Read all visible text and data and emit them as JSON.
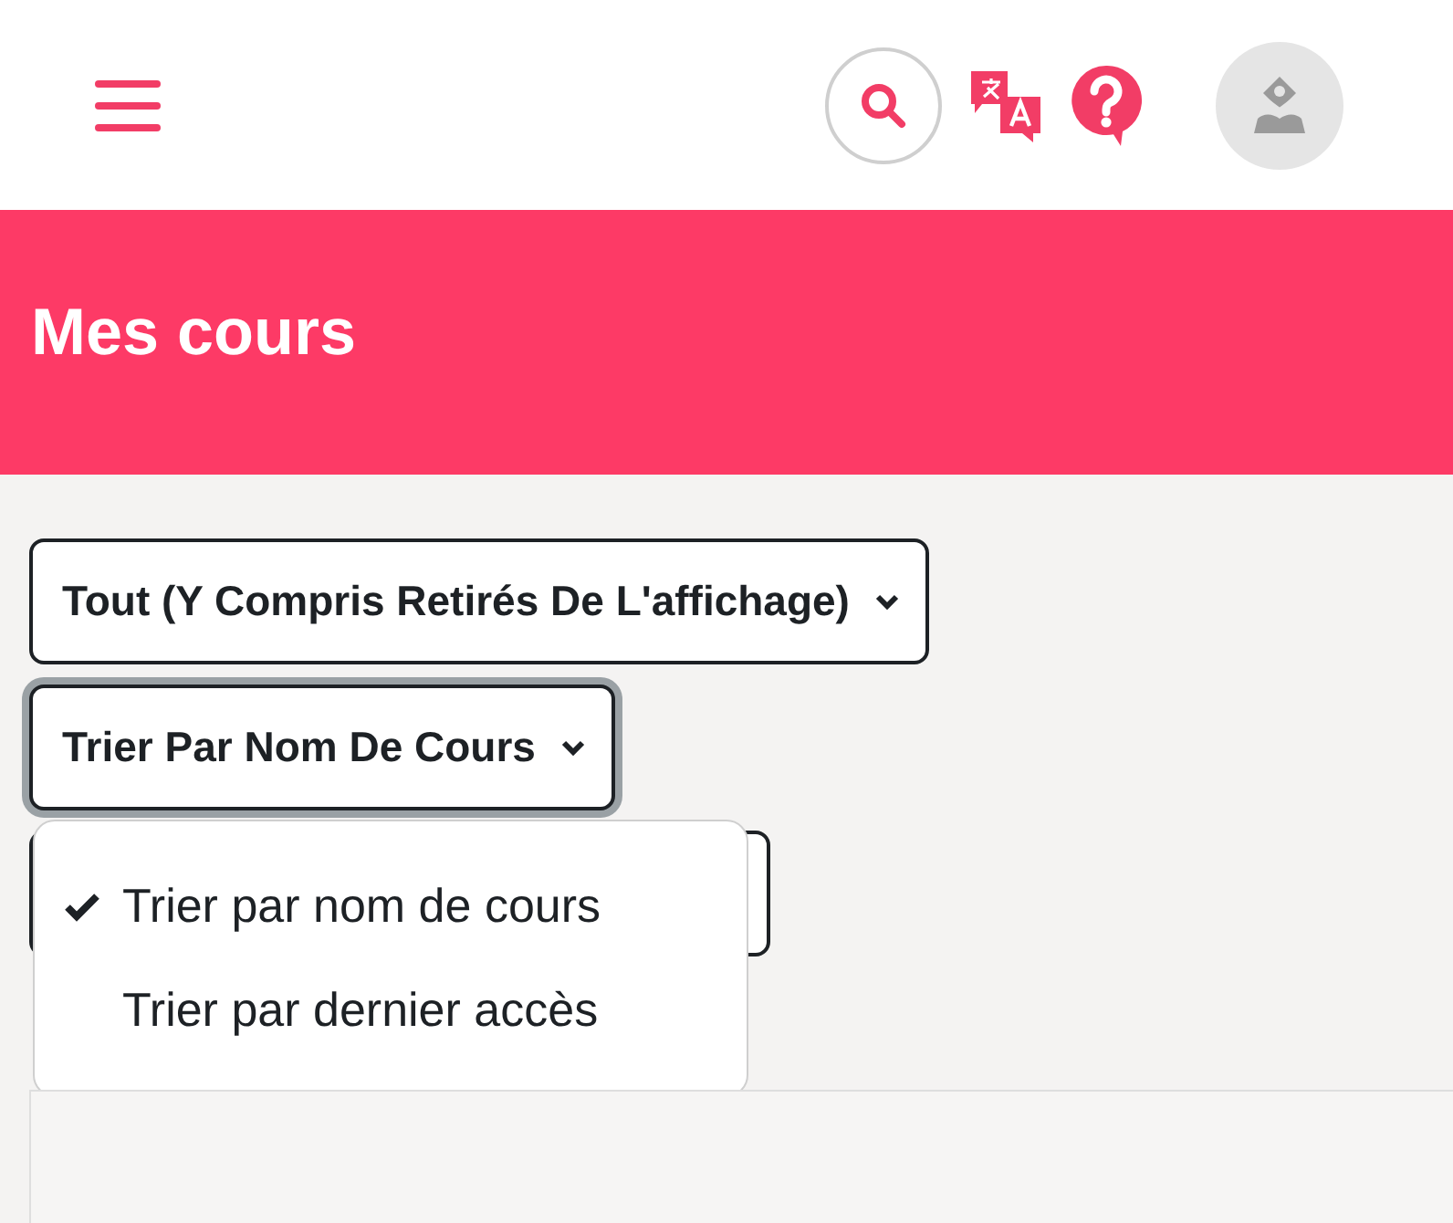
{
  "page_title": "Mes cours",
  "filters": [
    {
      "label": "Tout (Y Compris Retirés De L'affichage)",
      "focused": false
    },
    {
      "label": "Trier Par Nom De Cours",
      "focused": true
    }
  ],
  "sort_menu": [
    {
      "label": "Trier par nom de cours",
      "selected": true
    },
    {
      "label": "Trier par dernier accès",
      "selected": false
    }
  ]
}
